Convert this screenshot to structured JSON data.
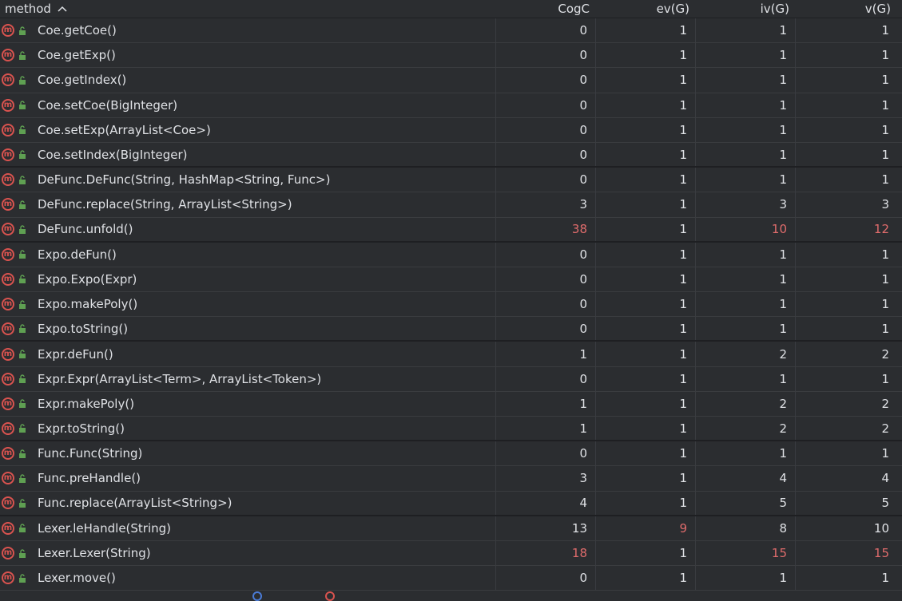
{
  "header": {
    "method": "method",
    "sort_icon": "chevron-up-icon",
    "cogc": "CogC",
    "evg": "ev(G)",
    "ivg": "iv(G)",
    "vg": "v(G)"
  },
  "colors": {
    "hot": "#e06c6c",
    "method_icon": "#d9534f",
    "lock_icon": "#5fa052"
  },
  "rows": [
    {
      "name": "Coe.getCoe()",
      "cogc": "0",
      "evg": "1",
      "ivg": "1",
      "vg": "1",
      "hot": []
    },
    {
      "name": "Coe.getExp()",
      "cogc": "0",
      "evg": "1",
      "ivg": "1",
      "vg": "1",
      "hot": []
    },
    {
      "name": "Coe.getIndex()",
      "cogc": "0",
      "evg": "1",
      "ivg": "1",
      "vg": "1",
      "hot": []
    },
    {
      "name": "Coe.setCoe(BigInteger)",
      "cogc": "0",
      "evg": "1",
      "ivg": "1",
      "vg": "1",
      "hot": []
    },
    {
      "name": "Coe.setExp(ArrayList<Coe>)",
      "cogc": "0",
      "evg": "1",
      "ivg": "1",
      "vg": "1",
      "hot": []
    },
    {
      "name": "Coe.setIndex(BigInteger)",
      "cogc": "0",
      "evg": "1",
      "ivg": "1",
      "vg": "1",
      "hot": []
    },
    {
      "name": "DeFunc.DeFunc(String, HashMap<String, Func>)",
      "cogc": "0",
      "evg": "1",
      "ivg": "1",
      "vg": "1",
      "hot": []
    },
    {
      "name": "DeFunc.replace(String, ArrayList<String>)",
      "cogc": "3",
      "evg": "1",
      "ivg": "3",
      "vg": "3",
      "hot": []
    },
    {
      "name": "DeFunc.unfold()",
      "cogc": "38",
      "evg": "1",
      "ivg": "10",
      "vg": "12",
      "hot": [
        "cogc",
        "ivg",
        "vg"
      ]
    },
    {
      "name": "Expo.deFun()",
      "cogc": "0",
      "evg": "1",
      "ivg": "1",
      "vg": "1",
      "hot": []
    },
    {
      "name": "Expo.Expo(Expr)",
      "cogc": "0",
      "evg": "1",
      "ivg": "1",
      "vg": "1",
      "hot": []
    },
    {
      "name": "Expo.makePoly()",
      "cogc": "0",
      "evg": "1",
      "ivg": "1",
      "vg": "1",
      "hot": []
    },
    {
      "name": "Expo.toString()",
      "cogc": "0",
      "evg": "1",
      "ivg": "1",
      "vg": "1",
      "hot": []
    },
    {
      "name": "Expr.deFun()",
      "cogc": "1",
      "evg": "1",
      "ivg": "2",
      "vg": "2",
      "hot": []
    },
    {
      "name": "Expr.Expr(ArrayList<Term>, ArrayList<Token>)",
      "cogc": "0",
      "evg": "1",
      "ivg": "1",
      "vg": "1",
      "hot": []
    },
    {
      "name": "Expr.makePoly()",
      "cogc": "1",
      "evg": "1",
      "ivg": "2",
      "vg": "2",
      "hot": []
    },
    {
      "name": "Expr.toString()",
      "cogc": "1",
      "evg": "1",
      "ivg": "2",
      "vg": "2",
      "hot": []
    },
    {
      "name": "Func.Func(String)",
      "cogc": "0",
      "evg": "1",
      "ivg": "1",
      "vg": "1",
      "hot": []
    },
    {
      "name": "Func.preHandle()",
      "cogc": "3",
      "evg": "1",
      "ivg": "4",
      "vg": "4",
      "hot": []
    },
    {
      "name": "Func.replace(ArrayList<String>)",
      "cogc": "4",
      "evg": "1",
      "ivg": "5",
      "vg": "5",
      "hot": []
    },
    {
      "name": "Lexer.leHandle(String)",
      "cogc": "13",
      "evg": "9",
      "ivg": "8",
      "vg": "10",
      "hot": [
        "evg"
      ]
    },
    {
      "name": "Lexer.Lexer(String)",
      "cogc": "18",
      "evg": "1",
      "ivg": "15",
      "vg": "15",
      "hot": [
        "cogc",
        "ivg",
        "vg"
      ]
    },
    {
      "name": "Lexer.move()",
      "cogc": "0",
      "evg": "1",
      "ivg": "1",
      "vg": "1",
      "hot": []
    }
  ]
}
